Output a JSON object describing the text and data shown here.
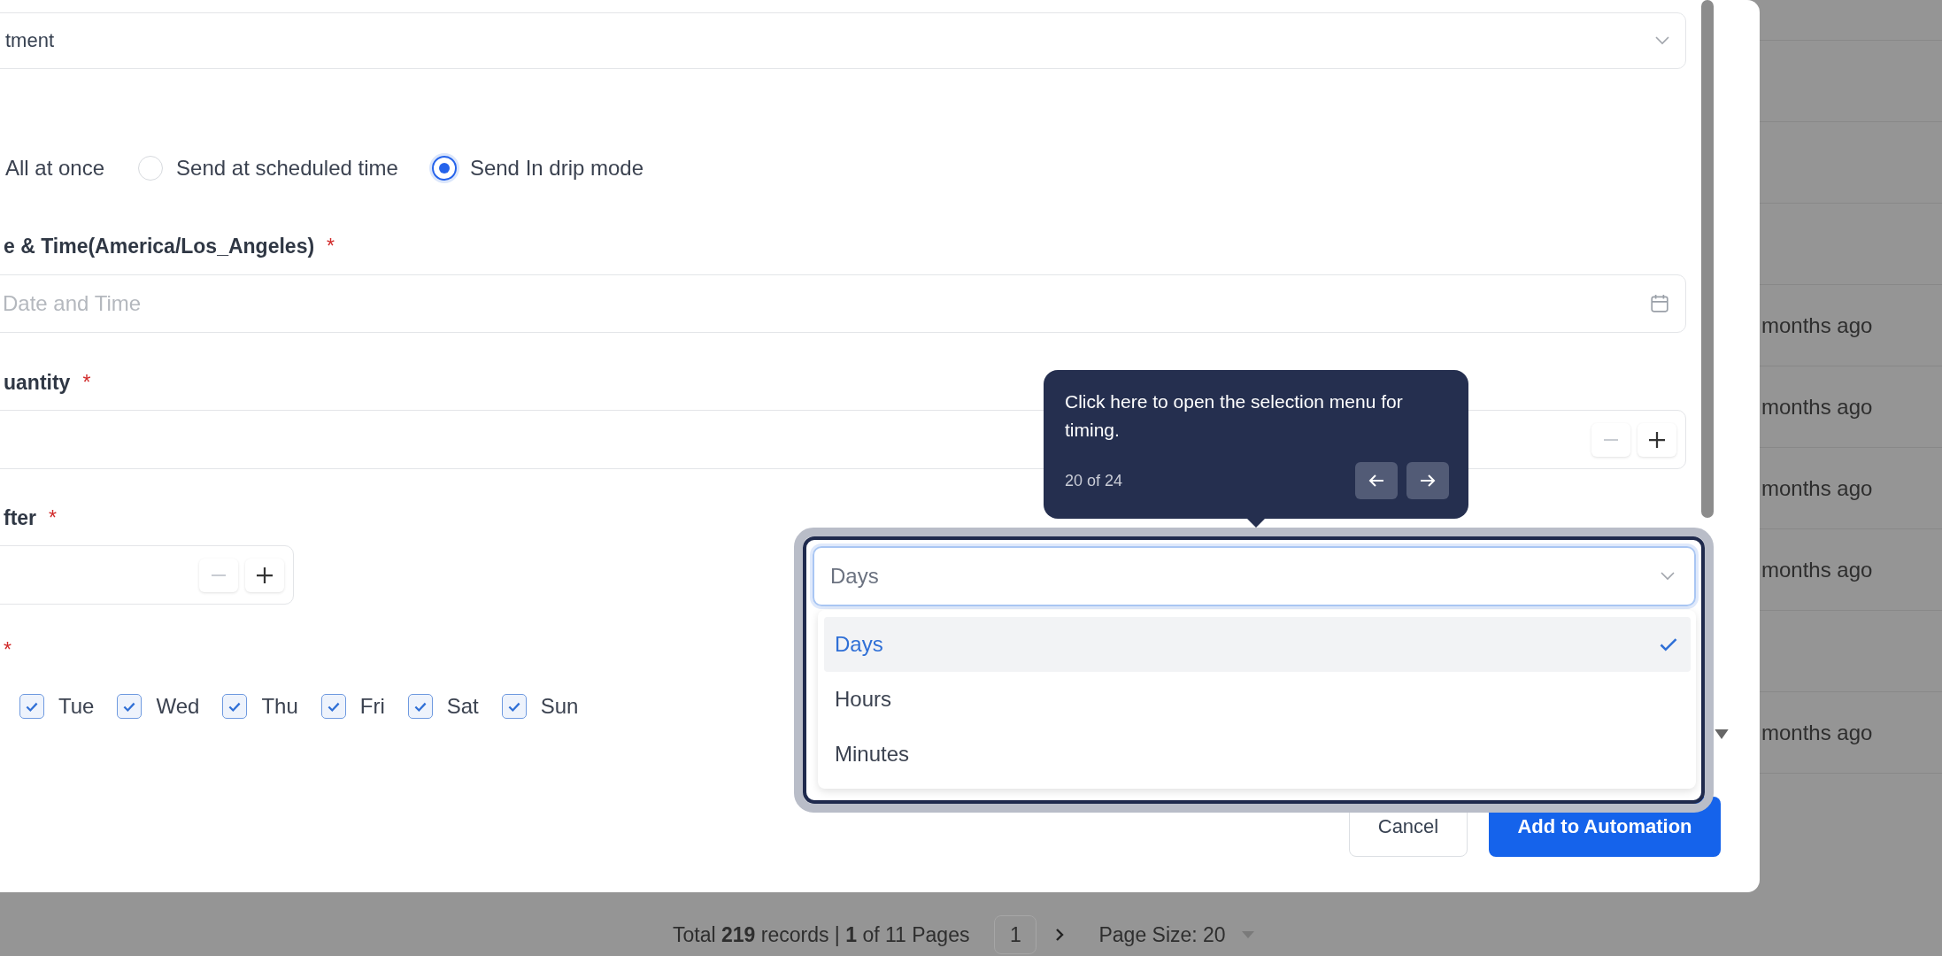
{
  "top_select": {
    "value": "tment"
  },
  "send_mode": {
    "options": [
      {
        "label": "All at once",
        "kind": "text"
      },
      {
        "label": "Send at scheduled time",
        "kind": "radio",
        "selected": false
      },
      {
        "label": "Send In drip mode",
        "kind": "radio",
        "selected": true
      }
    ]
  },
  "date_time": {
    "label": "e & Time(America/Los_Angeles)",
    "required_mark": "*",
    "placeholder": "Date and Time"
  },
  "quantity": {
    "label": "uantity",
    "required_mark": "*"
  },
  "after": {
    "label": "fter",
    "required_mark": "*"
  },
  "days": {
    "required_mark": "*",
    "items": [
      {
        "label": "Tue",
        "checked": true
      },
      {
        "label": "Wed",
        "checked": true
      },
      {
        "label": "Thu",
        "checked": true
      },
      {
        "label": "Fri",
        "checked": true
      },
      {
        "label": "Sat",
        "checked": true
      },
      {
        "label": "Sun",
        "checked": true
      }
    ]
  },
  "unit_select": {
    "value": "Days",
    "options": [
      {
        "label": "Days",
        "selected": true
      },
      {
        "label": "Hours",
        "selected": false
      },
      {
        "label": "Minutes",
        "selected": false
      }
    ]
  },
  "tour": {
    "text": "Click here to open the selection menu for timing.",
    "step": "20 of 24"
  },
  "buttons": [
    {
      "label": "Cancel",
      "kind": "secondary"
    },
    {
      "label": "Add to Automation",
      "kind": "primary"
    }
  ],
  "background_rows": [
    "months ago",
    "months ago",
    "months ago",
    "months ago",
    "months ago"
  ],
  "pagination": {
    "summary": "Total **219** records | **1** of 11 Pages",
    "page": "1",
    "page_size": "Page Size: 20"
  }
}
